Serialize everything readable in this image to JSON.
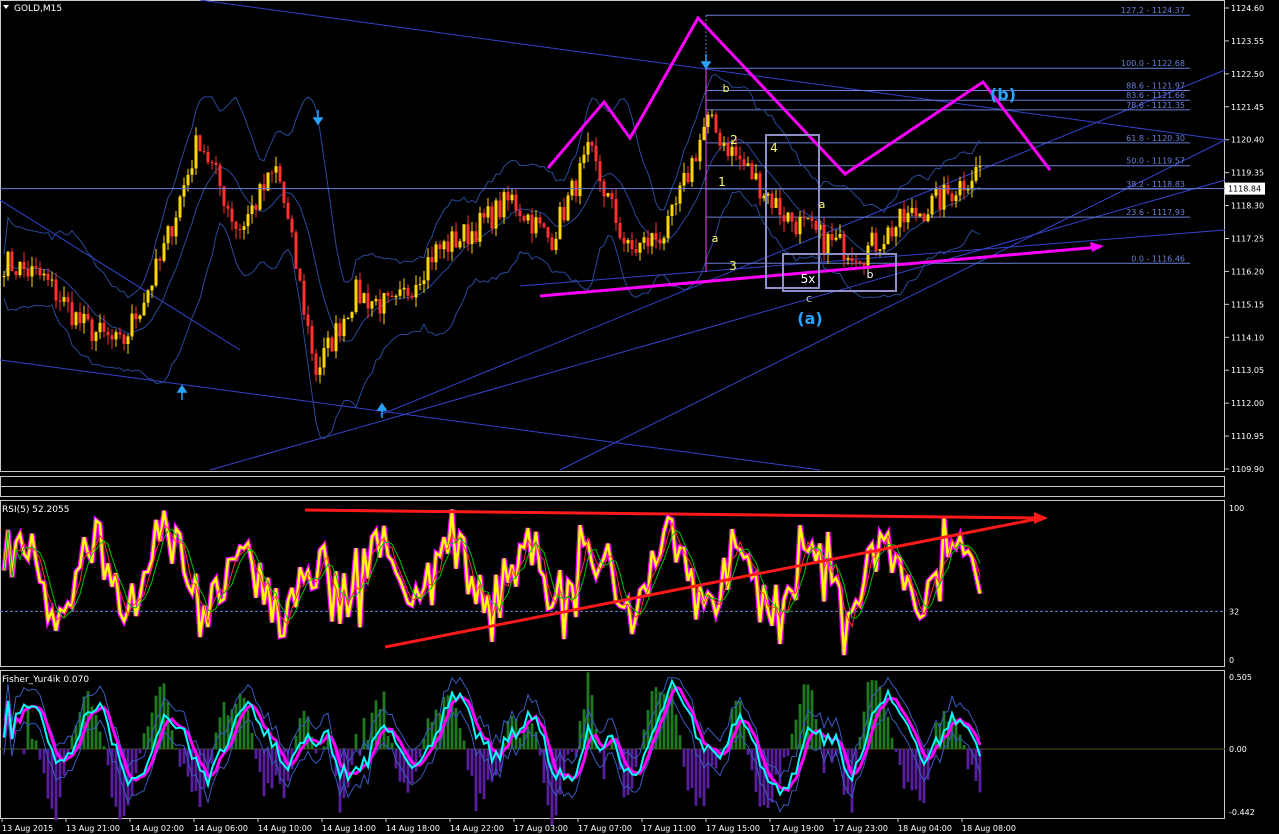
{
  "main": {
    "symbol_title": "GOLD,M15",
    "current_price": "1118.84",
    "price_ticks": [
      "1124.60",
      "1123.55",
      "1122.50",
      "1121.45",
      "1120.40",
      "1119.35",
      "1118.30",
      "1117.25",
      "1116.20",
      "1115.15",
      "1114.10",
      "1113.05",
      "1112.00",
      "1110.95",
      "1109.90"
    ],
    "fib_levels": [
      "127.2 - 1124.37",
      "100.0 - 1122.68",
      "88.6 - 1121.97",
      "83.6 - 1121.66",
      "78.6 - 1121.35",
      "61.8 - 1120.30",
      "50.0 - 1119.57",
      "38.2 - 1118.83",
      "23.6 - 1117.93",
      "0.0 - 1116.46"
    ],
    "wave_labels": [
      "1",
      "2",
      "3",
      "4",
      "5x",
      "a",
      "b",
      "c",
      "a",
      "b",
      "(a)",
      "(b)"
    ]
  },
  "rsi": {
    "title": "RSI(5) 52.2055",
    "ticks": [
      "100",
      "32",
      "0"
    ]
  },
  "fisher": {
    "title": "Fisher_Yur4ik 0.070",
    "ticks": [
      "0.505",
      "0.00",
      "-0.442"
    ]
  },
  "time_axis": [
    "13 Aug 2015",
    "13 Aug 21:00",
    "14 Aug 02:00",
    "14 Aug 06:00",
    "14 Aug 10:00",
    "14 Aug 14:00",
    "14 Aug 18:00",
    "14 Aug 22:00",
    "17 Aug 03:00",
    "17 Aug 07:00",
    "17 Aug 11:00",
    "17 Aug 15:00",
    "17 Aug 19:00",
    "17 Aug 23:00",
    "18 Aug 04:00",
    "18 Aug 08:00"
  ],
  "colors": {
    "bull": "#ffd700",
    "bear": "#ff3030",
    "fib": "#6a7fd8",
    "arrow": "#ff00ff",
    "rsi": "#ffff00",
    "rsi_trend": "#ff1a1a",
    "fisher_fast": "#00ffff",
    "fisher_slow": "#ff00ff",
    "hist_pos": "#1f7a1f",
    "hist_neg": "#5a1fa0",
    "wave": "#29a3ff"
  },
  "chart_data": {
    "type": "candlestick",
    "title": "GOLD,M15",
    "ylim": [
      1109.5,
      1125.0
    ],
    "x": [
      "13 Aug 2015",
      "13 Aug 21:00",
      "14 Aug 02:00",
      "14 Aug 06:00",
      "14 Aug 10:00",
      "14 Aug 14:00",
      "14 Aug 18:00",
      "14 Aug 22:00",
      "17 Aug 03:00",
      "17 Aug 07:00",
      "17 Aug 11:00",
      "17 Aug 15:00",
      "17 Aug 19:00",
      "17 Aug 23:00",
      "18 Aug 04:00",
      "18 Aug 08:00"
    ],
    "price_path": [
      1116.5,
      1116.0,
      1114.5,
      1113.8,
      1116.5,
      1120.5,
      1117.5,
      1119.5,
      1113.0,
      1115.5,
      1115.0,
      1116.8,
      1117.5,
      1118.5,
      1117.2,
      1120.0,
      1116.8,
      1117.5,
      1121.0,
      1119.5,
      1118.0,
      1117.2,
      1116.8,
      1117.8,
      1118.5,
      1119.5
    ],
    "fib_retracement": [
      {
        "level": "127.2",
        "price": 1124.37
      },
      {
        "level": "100.0",
        "price": 1122.68
      },
      {
        "level": "88.6",
        "price": 1121.97
      },
      {
        "level": "83.6",
        "price": 1121.66
      },
      {
        "level": "78.6",
        "price": 1121.35
      },
      {
        "level": "61.8",
        "price": 1120.3
      },
      {
        "level": "50.0",
        "price": 1119.57
      },
      {
        "level": "38.2",
        "price": 1118.83
      },
      {
        "level": "23.6",
        "price": 1117.93
      },
      {
        "level": "0.0",
        "price": 1116.46
      }
    ],
    "current_price": 1118.84,
    "rsi": {
      "period": 5,
      "value": 52.2055,
      "ylim": [
        0,
        100
      ],
      "levels": [
        32
      ]
    },
    "fisher": {
      "value": 0.07,
      "ylim": [
        -0.442,
        0.505
      ]
    }
  }
}
